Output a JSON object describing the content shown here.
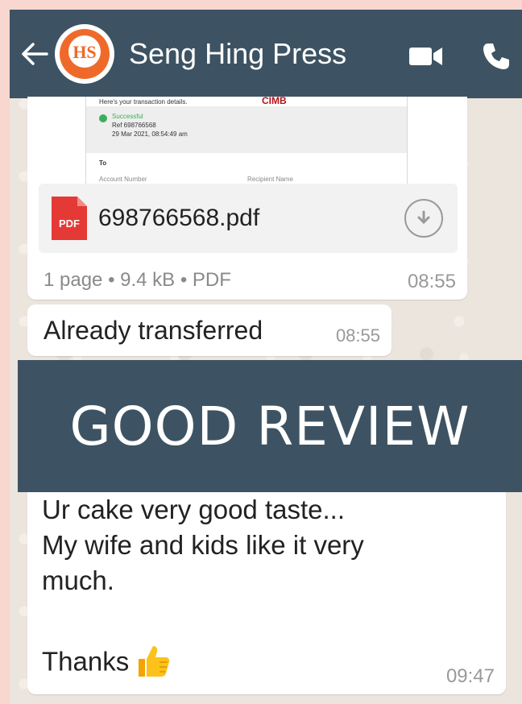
{
  "header": {
    "contact_name": "Seng Hing Press",
    "avatar_text": "HS",
    "back_icon": "arrow-left-icon",
    "video_icon": "video-camera-icon",
    "call_icon": "phone-icon"
  },
  "document_message": {
    "preview": {
      "line1": "Here's your transaction details.",
      "brand": "CIMB",
      "status": "Successful",
      "ref": "Ref 698766568",
      "datetime": "29 Mar 2021, 08:54:49 am",
      "to_label": "To",
      "col1": "Account Number",
      "col2": "Recipient Name"
    },
    "file_icon_text": "PDF",
    "file_name": "698766568.pdf",
    "meta": "1 page • 9.4 kB • PDF",
    "time": "08:55"
  },
  "text_message_1": {
    "text": "Already transferred",
    "time": "08:55"
  },
  "banner": {
    "text": "GOOD REVIEW"
  },
  "text_message_2": {
    "line1": "Ur cake very good taste...",
    "line2": "My wife and kids like it very",
    "line3": "much.",
    "line4": "Thanks",
    "time": "09:47"
  },
  "colors": {
    "header_bg": "#3d5363",
    "chat_bg": "#ece5dd",
    "border_bg": "#f7d7cf",
    "pdf_red": "#e53935"
  }
}
